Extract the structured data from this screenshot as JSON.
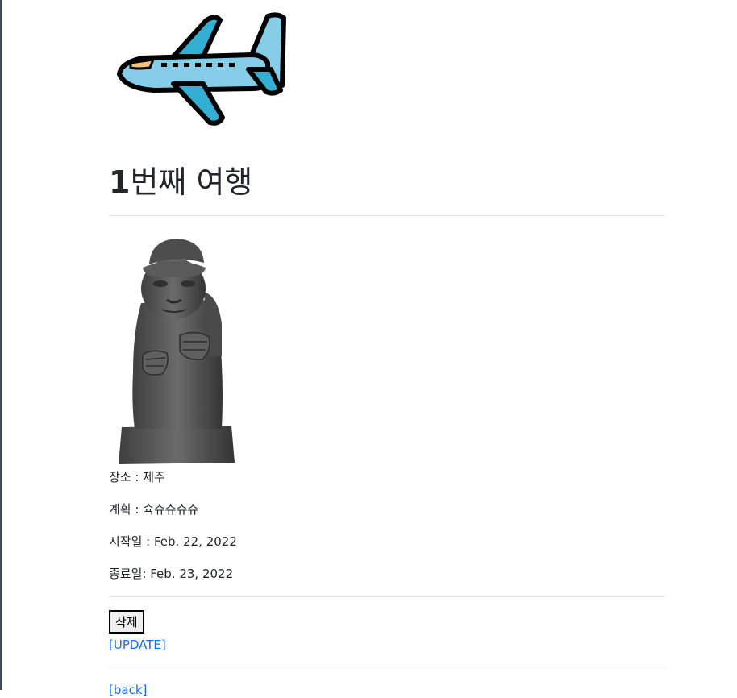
{
  "logo": {
    "icon": "airplane-icon",
    "colors": {
      "body": "#86cde8",
      "wing": "#34aed2",
      "outline": "#000000",
      "nose": "#f4c27a"
    }
  },
  "trip": {
    "title_number": "1",
    "title_rest": "번째 여행",
    "photo": {
      "icon": "dol-hareubang-statue-image"
    },
    "location": "장소 : 제주",
    "plan": "계획 : 슉슈슈슈슈",
    "start_date": "시작일 : Feb. 22, 2022",
    "end_date": "종료일: Feb. 23, 2022"
  },
  "actions": {
    "delete_label": "삭제",
    "update_label": "[UPDATE]",
    "back_label": "[back]"
  }
}
